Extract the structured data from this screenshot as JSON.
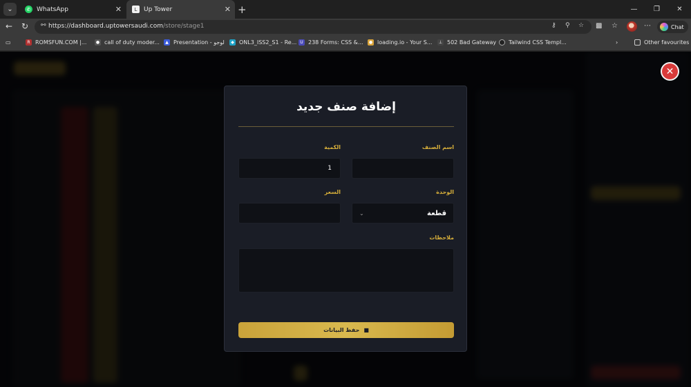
{
  "browser": {
    "tabs": [
      {
        "title": "WhatsApp",
        "icon": "whatsapp-icon"
      },
      {
        "title": "Up Tower",
        "icon": "uptower-favicon"
      }
    ],
    "url_host": "https://dashboard.uptowersaudi.com",
    "url_path": "/store/stage1",
    "chat_label": "Chat",
    "bookmarks": [
      "ROMSFUN.COM |...",
      "call of duty moder...",
      "Presentation - لوجو",
      "ONL3_ISS2_S1 - Re...",
      "238 Forms: CSS &...",
      "loading.io - Your S...",
      "502 Bad Gateway",
      "Tailwind CSS Templ..."
    ],
    "other_favourites": "Other favourites"
  },
  "modal": {
    "title": "إضافة صنف جديد",
    "fields": {
      "item_name_label": "اسم الصنف",
      "item_name_value": "",
      "quantity_label": "الكمية",
      "quantity_value": "1",
      "unit_label": "الوحدة",
      "unit_value": "قطعة",
      "price_label": "السعر",
      "price_value": "",
      "notes_label": "ملاحظات",
      "notes_value": ""
    },
    "save_label": "حفظ البيانات"
  },
  "colors": {
    "accent_gold": "#d6ae3a",
    "modal_bg": "#1a1d26",
    "close_red": "#d93a3a"
  }
}
